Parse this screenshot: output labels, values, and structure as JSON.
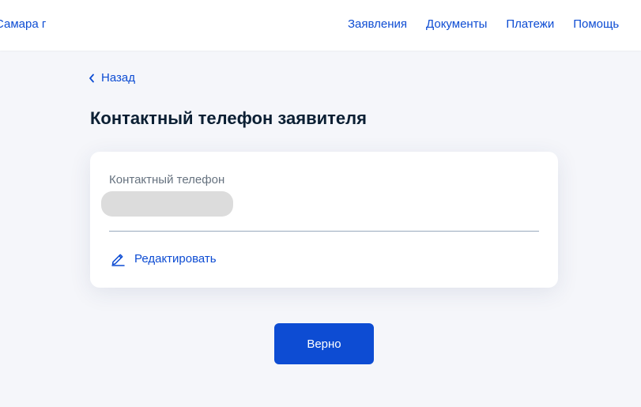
{
  "header": {
    "location": "Самара г",
    "nav": [
      {
        "label": "Заявления"
      },
      {
        "label": "Документы"
      },
      {
        "label": "Платежи"
      },
      {
        "label": "Помощь"
      }
    ]
  },
  "back": {
    "label": "Назад",
    "icon": "chevron-left-icon"
  },
  "page": {
    "title": "Контактный телефон заявителя"
  },
  "card": {
    "field_label": "Контактный телефон",
    "edit_label": "Редактировать",
    "edit_icon": "pencil-icon"
  },
  "actions": {
    "confirm_label": "Верно"
  },
  "colors": {
    "accent": "#0d4cd3",
    "background": "#f5f6fa",
    "text": "#0b1f33",
    "muted_text": "#66727f"
  }
}
